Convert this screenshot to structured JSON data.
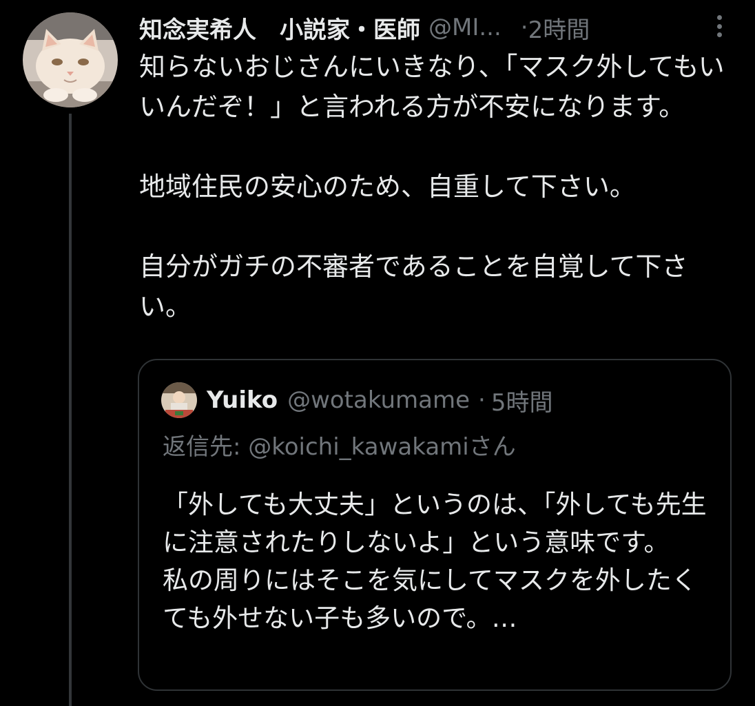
{
  "tweet": {
    "author": {
      "display_name": "知念実希人　小説家・医師",
      "handle": "@MI...",
      "avatar": "cat-avatar"
    },
    "separator": "·",
    "timestamp": "2時間",
    "more_icon": "more-vertical-icon",
    "paragraphs": [
      "知らないおじさんにいきなり、「マスク外してもいいんだぞ！」と言われる方が不安になります。",
      "地域住民の安心のため、自重して下さい。",
      "自分がガチの不審者であることを自覚して下さい。"
    ]
  },
  "quoted_tweet": {
    "author": {
      "display_name": "Yuiko",
      "handle": "@wotakumame",
      "avatar": "yuiko-avatar"
    },
    "separator": "·",
    "timestamp": "5時間",
    "reply_prefix": "返信先: ",
    "reply_mention": "@koichi_kawakami",
    "reply_suffix": "さん",
    "body_lines": [
      "「外しても大丈夫」というのは、「外しても先生に注意されたりしないよ」という意味です。",
      "私の周りにはそこを気にしてマスクを外したくても外せない子も多いので。…"
    ]
  },
  "colors": {
    "background": "#000000",
    "primary_text": "#e7e9ea",
    "secondary_text": "#71767b",
    "border": "#2f3336",
    "thread_line": "#333639"
  }
}
